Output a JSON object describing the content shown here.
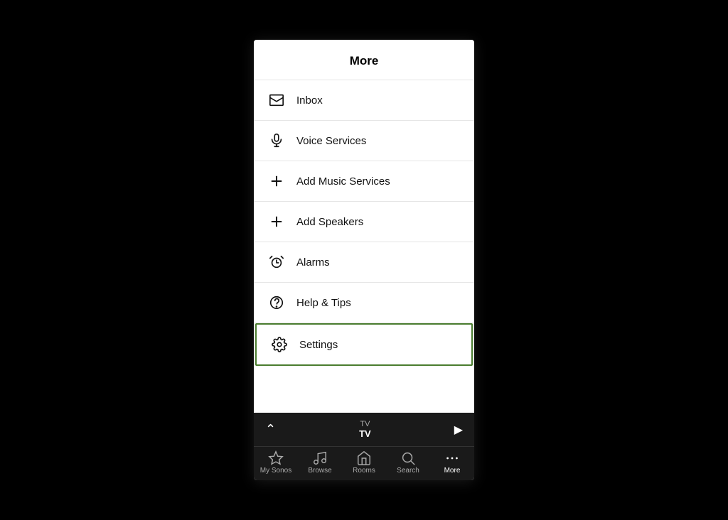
{
  "header": {
    "title": "More"
  },
  "menu": {
    "items": [
      {
        "id": "inbox",
        "label": "Inbox",
        "icon": "inbox-icon",
        "highlighted": false
      },
      {
        "id": "voice-services",
        "label": "Voice Services",
        "icon": "microphone-icon",
        "highlighted": false
      },
      {
        "id": "add-music",
        "label": "Add Music Services",
        "icon": "add-music-icon",
        "highlighted": false
      },
      {
        "id": "add-speakers",
        "label": "Add Speakers",
        "icon": "add-speakers-icon",
        "highlighted": false
      },
      {
        "id": "alarms",
        "label": "Alarms",
        "icon": "alarm-icon",
        "highlighted": false
      },
      {
        "id": "help",
        "label": "Help & Tips",
        "icon": "help-icon",
        "highlighted": false
      },
      {
        "id": "settings",
        "label": "Settings",
        "icon": "settings-icon",
        "highlighted": true
      }
    ]
  },
  "transport": {
    "tv_top": "TV",
    "tv_bottom": "TV"
  },
  "bottom_nav": {
    "items": [
      {
        "id": "my-sonos",
        "label": "My Sonos",
        "active": false
      },
      {
        "id": "browse",
        "label": "Browse",
        "active": false
      },
      {
        "id": "rooms",
        "label": "Rooms",
        "active": false
      },
      {
        "id": "search",
        "label": "Search",
        "active": false
      },
      {
        "id": "more",
        "label": "More",
        "active": true
      }
    ]
  }
}
